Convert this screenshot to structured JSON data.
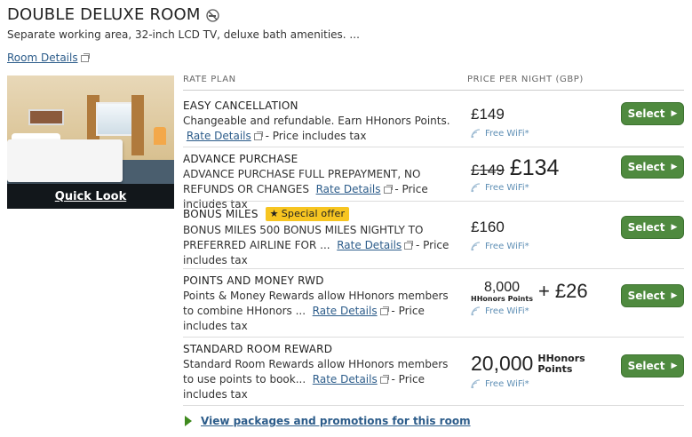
{
  "room": {
    "title": "DOUBLE DELUXE ROOM",
    "description": "Separate working area, 32-inch LCD TV, deluxe bath amenities. ...",
    "details_link": "Room Details",
    "quick_look": "Quick Look"
  },
  "table": {
    "col_rate_plan": "RATE PLAN",
    "col_price": "PRICE PER NIGHT (GBP)"
  },
  "rates": [
    {
      "title": "EASY CANCELLATION",
      "desc_pre": "Changeable and refundable. Earn HHonors Points.",
      "link": "Rate Details",
      "desc_post": " - Price includes tax",
      "price": "£149",
      "wifi": "Free WiFi*",
      "button": "Select"
    },
    {
      "title": "ADVANCE PURCHASE",
      "desc_pre": "ADVANCE PURCHASE FULL PREPAYMENT, NO REFUNDS OR CHANGES",
      "link": "Rate Details",
      "desc_post": " - Price includes tax",
      "price_old": "£149",
      "price": "£134",
      "wifi": "Free WiFi*",
      "button": "Select"
    },
    {
      "title": "BONUS MILES",
      "badge": "Special offer",
      "desc_pre": "BONUS MILES 500 BONUS MILES NIGHTLY TO PREFERRED AIRLINE FOR ...",
      "link": "Rate Details",
      "desc_post": " - Price includes tax",
      "price": "£160",
      "wifi": "Free WiFi*",
      "button": "Select"
    },
    {
      "title": "POINTS AND MONEY RWD",
      "desc_pre": "Points & Money Rewards allow HHonors members to combine HHonors ...",
      "link": "Rate Details",
      "desc_post": " - Price includes tax",
      "points": "8,000",
      "points_label": "HHonors Points",
      "plus_price": "+ £26",
      "wifi": "Free WiFi*",
      "button": "Select"
    },
    {
      "title": "STANDARD ROOM REWARD",
      "desc_pre": "Standard Room Rewards allow HHonors members to use points to book...",
      "link": "Rate Details",
      "desc_post": " - Price includes tax",
      "points": "20,000",
      "points_label_1": "HHonors",
      "points_label_2": "Points",
      "wifi": "Free WiFi*",
      "button": "Select"
    }
  ],
  "footer": {
    "packages_link": "View packages and promotions for this room"
  },
  "colors": {
    "button_green": "#4f8a3f",
    "link_blue": "#2c5c8a",
    "badge_yellow": "#f7c521",
    "wifi_blue": "#5f8fb5"
  }
}
